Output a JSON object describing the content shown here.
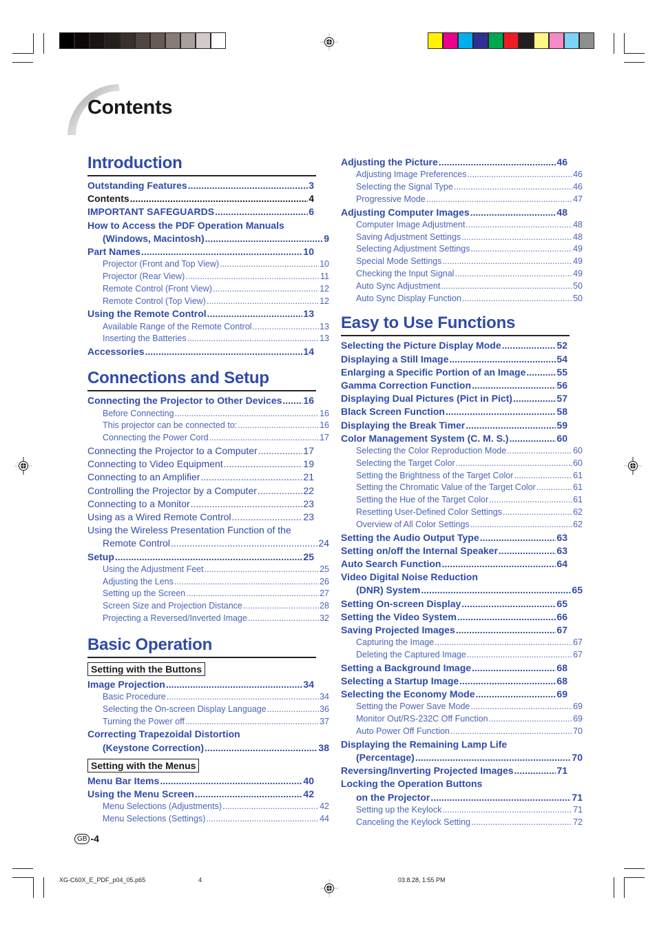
{
  "title": "Contents",
  "grayscale_swatches": [
    "#000000",
    "#0b0807",
    "#181412",
    "#231f1c",
    "#3a302d",
    "#4f4541",
    "#665b57",
    "#867c78",
    "#a9a09d",
    "#d3cbca",
    "#ffffff"
  ],
  "color_swatches": [
    "#fff200",
    "#ec008c",
    "#00aeef",
    "#2e3192",
    "#00a651",
    "#ed1c24",
    "#231f20",
    "#fff685",
    "#f58ac5",
    "#7dd3f7",
    "#8f8f8f"
  ],
  "accent_color": "#2f4aa8",
  "sections": {
    "introduction": {
      "heading": "Introduction",
      "entries": [
        {
          "label": "Outstanding Features",
          "page": "3",
          "level": "bold"
        },
        {
          "label": "Contents",
          "page": "4",
          "level": "bold-black"
        },
        {
          "label": "IMPORTANT SAFEGUARDS",
          "page": "6",
          "level": "bold"
        },
        {
          "label": "How to Access the PDF Operation Manuals",
          "label_cont": "(Windows, Macintosh)",
          "page": "9",
          "level": "bold"
        },
        {
          "label": "Part Names",
          "page": "10",
          "level": "bold"
        },
        {
          "label": "Projector (Front and Top View)",
          "page": "10",
          "level": "sub"
        },
        {
          "label": "Projector (Rear View)",
          "page": "11",
          "level": "sub"
        },
        {
          "label": "Remote Control (Front View)",
          "page": "12",
          "level": "sub"
        },
        {
          "label": "Remote Control (Top View)",
          "page": "12",
          "level": "sub"
        },
        {
          "label": "Using the Remote Control",
          "page": "13",
          "level": "bold"
        },
        {
          "label": "Available Range of the Remote Control",
          "page": "13",
          "level": "sub"
        },
        {
          "label": "Inserting the Batteries",
          "page": "13",
          "level": "sub"
        },
        {
          "label": "Accessories",
          "page": "14",
          "level": "bold"
        }
      ]
    },
    "connections": {
      "heading": "Connections and Setup",
      "entries": [
        {
          "label": "Connecting the Projector to Other Devices",
          "page": "16",
          "level": "bold"
        },
        {
          "label": "Before Connecting",
          "page": "16",
          "level": "sub"
        },
        {
          "label": "This projector can be connected to:",
          "page": "16",
          "level": "sub"
        },
        {
          "label": "Connecting the Power Cord",
          "page": "17",
          "level": "sub"
        },
        {
          "label": "Connecting the Projector to a Computer",
          "page": "17",
          "level": "normal"
        },
        {
          "label": "Connecting to Video Equipment",
          "page": "19",
          "level": "normal"
        },
        {
          "label": "Connecting to an Amplifier",
          "page": "21",
          "level": "normal"
        },
        {
          "label": "Controlling the Projector by a Computer",
          "page": "22",
          "level": "normal"
        },
        {
          "label": "Connecting to a Monitor",
          "page": "23",
          "level": "normal"
        },
        {
          "label": "Using as a Wired Remote Control",
          "page": "23",
          "level": "normal"
        },
        {
          "label": "Using the Wireless Presentation Function of the",
          "label_cont": "Remote Control",
          "page": "24",
          "level": "normal"
        },
        {
          "label": "Setup",
          "page": "25",
          "level": "bold"
        },
        {
          "label": "Using the Adjustment Feet",
          "page": "25",
          "level": "sub"
        },
        {
          "label": "Adjusting the Lens",
          "page": "26",
          "level": "sub"
        },
        {
          "label": "Setting up the Screen",
          "page": "27",
          "level": "sub"
        },
        {
          "label": "Screen Size and Projection Distance",
          "page": "28",
          "level": "sub"
        },
        {
          "label": "Projecting a Reversed/Inverted Image",
          "page": "32",
          "level": "sub"
        }
      ]
    },
    "basic": {
      "heading": "Basic Operation",
      "group1_label": "Setting with the Buttons",
      "group1": [
        {
          "label": "Image Projection",
          "page": "34",
          "level": "bold"
        },
        {
          "label": "Basic Procedure",
          "page": "34",
          "level": "sub"
        },
        {
          "label": "Selecting the On-screen Display Language",
          "page": "36",
          "level": "sub"
        },
        {
          "label": "Turning the Power off",
          "page": "37",
          "level": "sub"
        },
        {
          "label": "Correcting Trapezoidal Distortion",
          "label_cont": "(Keystone Correction)",
          "page": "38",
          "level": "bold"
        }
      ],
      "group2_label": "Setting with the Menus",
      "group2": [
        {
          "label": "Menu Bar Items",
          "page": "40",
          "level": "bold"
        },
        {
          "label": "Using the Menu Screen",
          "page": "42",
          "level": "bold"
        },
        {
          "label": "Menu Selections (Adjustments)",
          "page": "42",
          "level": "sub"
        },
        {
          "label": "Menu Selections (Settings)",
          "page": "44",
          "level": "sub"
        }
      ]
    },
    "basic_cont": {
      "entries": [
        {
          "label": "Adjusting the Picture",
          "page": "46",
          "level": "bold"
        },
        {
          "label": "Adjusting Image Preferences",
          "page": "46",
          "level": "sub"
        },
        {
          "label": "Selecting the Signal Type",
          "page": "46",
          "level": "sub"
        },
        {
          "label": "Progressive Mode",
          "page": "47",
          "level": "sub"
        },
        {
          "label": "Adjusting Computer Images",
          "page": "48",
          "level": "bold"
        },
        {
          "label": "Computer Image Adjustment",
          "page": "48",
          "level": "sub"
        },
        {
          "label": "Saving Adjustment Settings",
          "page": "48",
          "level": "sub"
        },
        {
          "label": "Selecting Adjustment Settings",
          "page": "49",
          "level": "sub"
        },
        {
          "label": "Special Mode Settings",
          "page": "49",
          "level": "sub"
        },
        {
          "label": "Checking the Input Signal",
          "page": "49",
          "level": "sub"
        },
        {
          "label": "Auto Sync Adjustment",
          "page": "50",
          "level": "sub"
        },
        {
          "label": "Auto Sync Display Function",
          "page": "50",
          "level": "sub"
        }
      ]
    },
    "easy": {
      "heading": "Easy to Use Functions",
      "entries": [
        {
          "label": "Selecting the Picture Display Mode",
          "page": "52",
          "level": "bold"
        },
        {
          "label": "Displaying a Still Image",
          "page": "54",
          "level": "bold"
        },
        {
          "label": "Enlarging a Specific Portion of an Image",
          "page": "55",
          "level": "bold"
        },
        {
          "label": "Gamma Correction Function",
          "page": "56",
          "level": "bold"
        },
        {
          "label": "Displaying Dual Pictures (Pict in Pict)",
          "page": "57",
          "level": "bold"
        },
        {
          "label": "Black Screen Function",
          "page": "58",
          "level": "bold"
        },
        {
          "label": "Displaying the Break Timer",
          "page": "59",
          "level": "bold"
        },
        {
          "label": "Color Management System (C. M. S.)",
          "page": "60",
          "level": "bold"
        },
        {
          "label": "Selecting the Color Reproduction Mode",
          "page": "60",
          "level": "sub"
        },
        {
          "label": "Selecting the Target Color",
          "page": "60",
          "level": "sub"
        },
        {
          "label": "Setting the Brightness of the Target Color",
          "page": "61",
          "level": "sub"
        },
        {
          "label": "Setting the Chromatic Value of the Target Color",
          "page": "61",
          "level": "sub"
        },
        {
          "label": "Setting the Hue of the Target Color",
          "page": "61",
          "level": "sub"
        },
        {
          "label": "Resetting User-Defined Color Settings",
          "page": "62",
          "level": "sub"
        },
        {
          "label": "Overview of All Color Settings",
          "page": "62",
          "level": "sub"
        },
        {
          "label": "Setting the Audio Output Type",
          "page": "63",
          "level": "bold"
        },
        {
          "label": "Setting on/off the Internal Speaker",
          "page": "63",
          "level": "bold"
        },
        {
          "label": "Auto Search Function",
          "page": "64",
          "level": "bold"
        },
        {
          "label": "Video Digital Noise Reduction",
          "label_cont": "(DNR) System",
          "page": "65",
          "level": "bold"
        },
        {
          "label": "Setting On-screen Display",
          "page": "65",
          "level": "bold"
        },
        {
          "label": "Setting the Video System",
          "page": "66",
          "level": "bold"
        },
        {
          "label": "Saving Projected Images",
          "page": "67",
          "level": "bold"
        },
        {
          "label": "Capturing the Image",
          "page": "67",
          "level": "sub"
        },
        {
          "label": "Deleting the Captured Image",
          "page": "67",
          "level": "sub"
        },
        {
          "label": "Setting a Background Image",
          "page": "68",
          "level": "bold"
        },
        {
          "label": "Selecting a Startup Image",
          "page": "68",
          "level": "bold"
        },
        {
          "label": "Selecting the Economy Mode",
          "page": "69",
          "level": "bold"
        },
        {
          "label": "Setting the Power Save Mode",
          "page": "69",
          "level": "sub"
        },
        {
          "label": "Monitor Out/RS-232C Off Function",
          "page": "69",
          "level": "sub"
        },
        {
          "label": "Auto Power Off Function",
          "page": "70",
          "level": "sub"
        },
        {
          "label": "Displaying the Remaining Lamp Life",
          "label_cont": "(Percentage)",
          "page": "70",
          "level": "bold"
        },
        {
          "label": "Reversing/Inverting Projected Images",
          "page": "71",
          "level": "bold"
        },
        {
          "label": "Locking the Operation Buttons",
          "label_cont": "on the Projector",
          "page": "71",
          "level": "bold"
        },
        {
          "label": "Setting up the Keylock",
          "page": "71",
          "level": "sub"
        },
        {
          "label": "Canceling the Keylock Setting",
          "page": "72",
          "level": "sub"
        }
      ]
    }
  },
  "footer": {
    "region_badge": "GB",
    "page_number": "-4",
    "slug_file": "XG-C60X_E_PDF_p04_05.p65",
    "slug_page": "4",
    "slug_timestamp": "03.8.28, 1:55 PM"
  }
}
